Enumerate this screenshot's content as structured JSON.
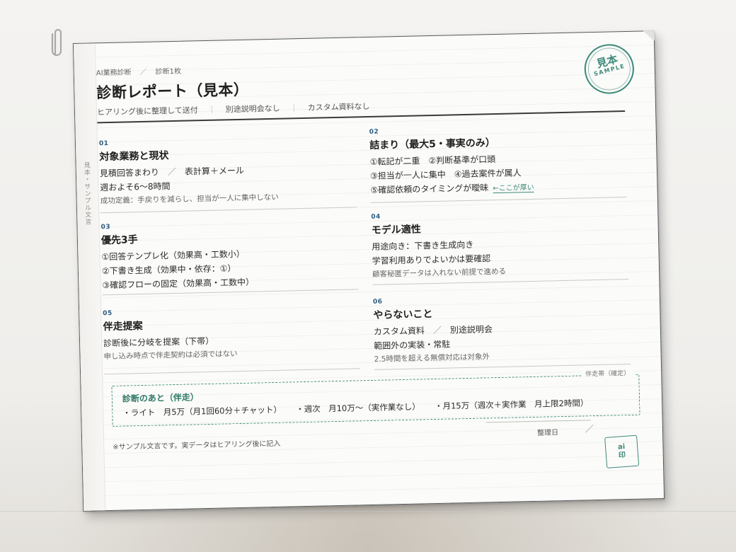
{
  "header": {
    "crumb_1": "AI業務診断",
    "crumb_sep": "／",
    "crumb_2": "診断1枚",
    "title": "診断レポート（見本）",
    "sub_1": "ヒアリング後に整理して送付",
    "sub_bar": "｜",
    "sub_2": "別途説明会なし",
    "sub_3": "カスタム資料なし"
  },
  "stamp": {
    "text_big": "見本",
    "text_small": "SAMPLE"
  },
  "side_text": "見本・サンプル文言",
  "sections": [
    {
      "num": "01",
      "head": "対象業務と現状",
      "line_1a": "見積回答まわり",
      "line_1_sep": "／",
      "line_1b": "表計算＋メール",
      "line_2": "週およそ6〜8時間",
      "note": "成功定義：手戻りを減らし、担当が一人に集中しない"
    },
    {
      "num": "02",
      "head": "詰まり（最大5・事実のみ）",
      "line_1": "①転記が二重　②判断基準が口頭",
      "line_2": "③担当が一人に集中　④過去案件が属人",
      "line_3": "⑤確認依頼のタイミングが曖昧",
      "tag": "←ここが厚い"
    },
    {
      "num": "03",
      "head": "優先3手",
      "line_1": "①回答テンプレ化（効果高・工数小）",
      "line_2": "②下書き生成（効果中・依存：①）",
      "line_3": "③確認フローの固定（効果高・工数中）"
    },
    {
      "num": "04",
      "head": "モデル適性",
      "line_1": "用途向き：下書き生成向き",
      "line_2": "学習利用ありでよいかは要確認",
      "note": "顧客秘匿データは入れない前提で進める"
    },
    {
      "num": "05",
      "head": "伴走提案",
      "line_1": "診断後に分岐を提案（下帯）",
      "note": "申し込み時点で伴走契約は必須ではない"
    },
    {
      "num": "06",
      "head": "やらないこと",
      "line_1a": "カスタム資料",
      "line_1_sep": "／",
      "line_1b": "別途説明会",
      "line_2": "範囲外の実装・常駐",
      "note": "2.5時間を超える無償対応は対象外"
    }
  ],
  "band": {
    "label": "伴走帯（確定）",
    "head": "診断のあと（伴走）",
    "items": [
      "・ライト　月5万（月1回60分＋チャット）",
      "・週次　月10万〜（実作業なし）",
      "・月15万（週次＋実作業　月上限2時間）"
    ]
  },
  "footer": {
    "note": "※サンプル文言です。実データはヒアリング後に記入",
    "date_label": "整理日",
    "date_slash": "／",
    "seal_line_1": "ai",
    "seal_line_2": "印"
  },
  "colors": {
    "accent": "#3d8a7a",
    "number": "#2d5d82",
    "ink": "#1f1f1f"
  }
}
